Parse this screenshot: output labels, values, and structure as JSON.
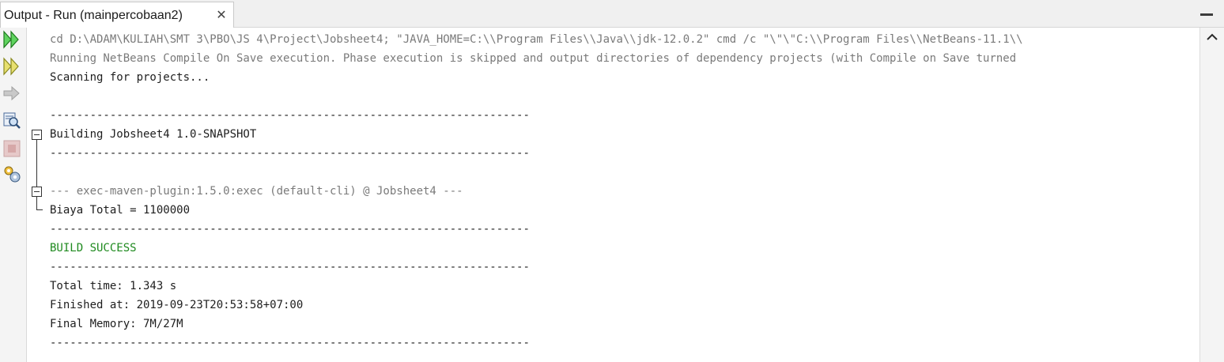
{
  "tab": {
    "title": "Output - Run (mainpercobaan2)",
    "close_glyph": "✕"
  },
  "toolbar": {
    "buttons": [
      {
        "name": "rerun-icon",
        "tooltip": ""
      },
      {
        "name": "rerun-with-options-icon",
        "tooltip": ""
      },
      {
        "name": "next-step-icon",
        "tooltip": ""
      },
      {
        "name": "inspect-icon",
        "tooltip": ""
      },
      {
        "name": "stop-icon",
        "tooltip": ""
      },
      {
        "name": "settings-icon",
        "tooltip": ""
      }
    ]
  },
  "output": {
    "lines": [
      "cd D:\\ADAM\\KULIAH\\SMT 3\\PBO\\JS 4\\Project\\Jobsheet4; \"JAVA_HOME=C:\\\\Program Files\\\\Java\\\\jdk-12.0.2\" cmd /c \"\\\"\\\"C:\\\\Program Files\\\\NetBeans-11.1\\\\",
      "Running NetBeans Compile On Save execution. Phase execution is skipped and output directories of dependency projects (with Compile on Save turned",
      "Scanning for projects...",
      "",
      "------------------------------------------------------------------------",
      "Building Jobsheet4 1.0-SNAPSHOT",
      "------------------------------------------------------------------------",
      "",
      "--- exec-maven-plugin:1.5.0:exec (default-cli) @ Jobsheet4 ---",
      "Biaya Total = 1100000",
      "------------------------------------------------------------------------",
      "BUILD SUCCESS",
      "------------------------------------------------------------------------",
      "Total time: 1.343 s",
      "Finished at: 2019-09-23T20:53:58+07:00",
      "Final Memory: 7M/27M",
      "------------------------------------------------------------------------"
    ],
    "line_styles": [
      "gray",
      "gray",
      "normal",
      "normal",
      "normal",
      "normal",
      "normal",
      "normal",
      "gray",
      "normal",
      "normal",
      "green",
      "normal",
      "normal",
      "normal",
      "normal",
      "normal"
    ]
  },
  "colors": {
    "rerun_green": "#2fa62f",
    "build_success": "#1f8a1f",
    "gray_text": "#7a7a7a"
  }
}
